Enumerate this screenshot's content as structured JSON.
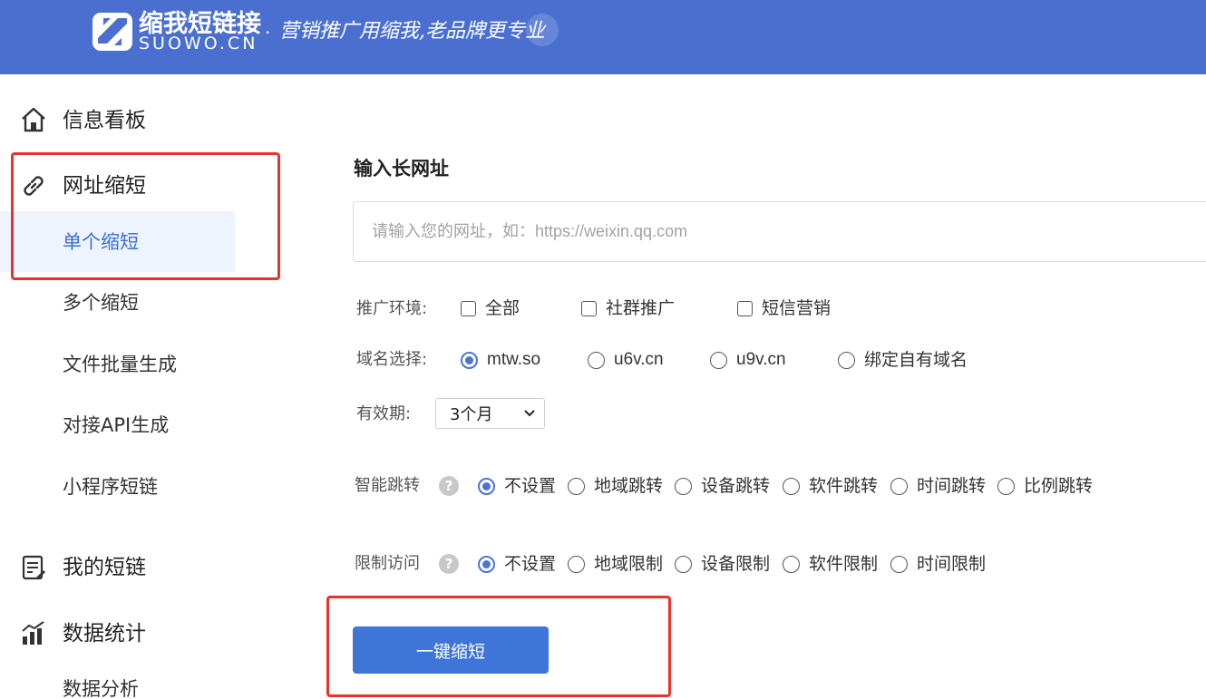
{
  "header": {
    "brand_cn": "缩我短链接",
    "brand_en": "SUOWO.CN",
    "separator": "·",
    "slogan": "营销推广用缩我,老品牌更专业"
  },
  "sidebar": {
    "items": [
      {
        "label": "信息看板",
        "icon": "home-icon"
      },
      {
        "label": "网址缩短",
        "icon": "link-icon"
      },
      {
        "label": "单个缩短",
        "active": true
      },
      {
        "label": "多个缩短"
      },
      {
        "label": "文件批量生成"
      },
      {
        "label": "对接API生成"
      },
      {
        "label": "小程序短链"
      },
      {
        "label": "我的短链",
        "icon": "list-icon"
      },
      {
        "label": "数据统计",
        "icon": "chart-icon"
      },
      {
        "label": "数据分析"
      }
    ]
  },
  "main": {
    "title": "输入长网址",
    "url_input": {
      "value": "",
      "placeholder": "请输入您的网址，如：https://weixin.qq.com"
    },
    "promo_env": {
      "label": "推广环境:",
      "options": [
        "全部",
        "社群推广",
        "短信营销"
      ]
    },
    "domain": {
      "label": "域名选择:",
      "options": [
        "mtw.so",
        "u6v.cn",
        "u9v.cn",
        "绑定自有域名"
      ],
      "selected": "mtw.so"
    },
    "validity": {
      "label": "有效期:",
      "selected": "3个月"
    },
    "smart_redirect": {
      "label": "智能跳转",
      "help": "?",
      "options": [
        "不设置",
        "地域跳转",
        "设备跳转",
        "软件跳转",
        "时间跳转",
        "比例跳转"
      ],
      "selected": "不设置"
    },
    "limit_access": {
      "label": "限制访问",
      "help": "?",
      "options": [
        "不设置",
        "地域限制",
        "设备限制",
        "软件限制",
        "时间限制"
      ],
      "selected": "不设置"
    },
    "submit_label": "一键缩短"
  },
  "colors": {
    "header_bg": "#4a6fd0",
    "accent": "#3f74d8",
    "highlight_box": "#e8322d",
    "active_bg": "#eef4fd"
  }
}
